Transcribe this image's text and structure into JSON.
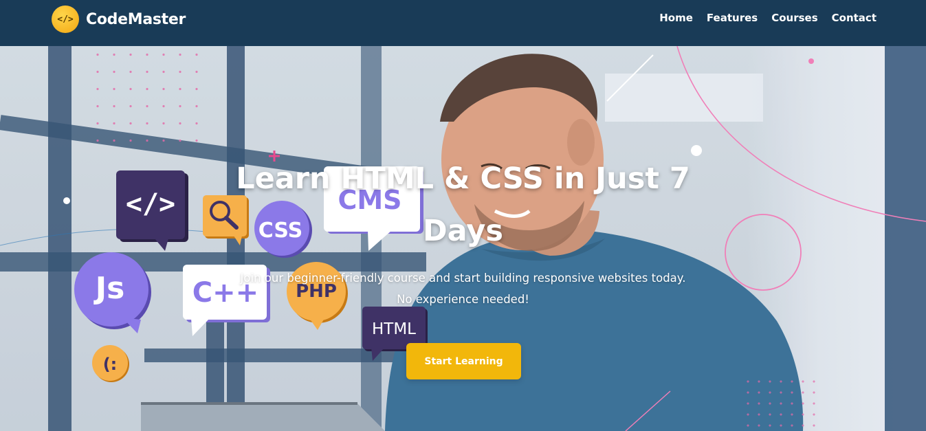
{
  "brand": {
    "name": "CodeMaster",
    "logo_icon": "code-brackets-icon",
    "logo_glyph": "</>"
  },
  "nav": {
    "items": [
      {
        "label": "Home"
      },
      {
        "label": "Features"
      },
      {
        "label": "Courses"
      },
      {
        "label": "Contact"
      }
    ]
  },
  "hero": {
    "title": "Learn HTML & CSS in Just 7 Days",
    "subtitle": "Join our beginner-friendly course and start building responsive websites today. No experience needed!",
    "cta_label": "Start Learning"
  },
  "bubbles": {
    "code": "</>",
    "search_icon": "magnifier-icon",
    "css": "CSS",
    "cms": "CMS",
    "js": "Js",
    "cpp": "C++",
    "php": "PHP",
    "html": "HTML",
    "emoticon": "(:"
  },
  "colors": {
    "navbar": "#193b57",
    "accent": "#f2b70b",
    "bubble_purple": "#8b79e8",
    "bubble_dark": "#3f3266",
    "bubble_orange": "#f6b04a"
  }
}
